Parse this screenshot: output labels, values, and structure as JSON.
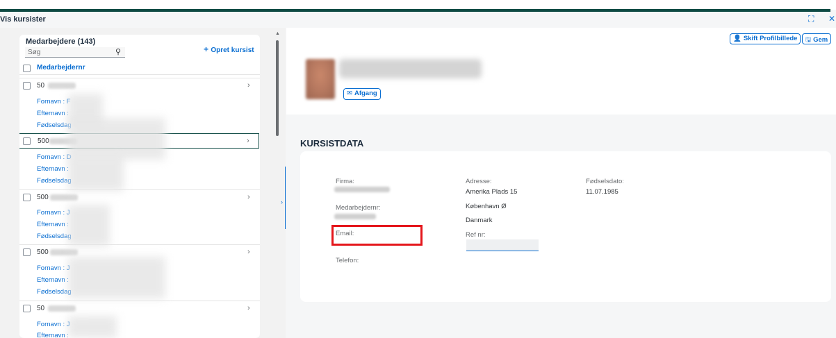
{
  "page": {
    "title": "Vis kursister"
  },
  "window_icons": {
    "fullscreen": "fullscreen-icon",
    "close": "close-icon"
  },
  "colors": {
    "accent": "#0a6ed1",
    "header_bar": "#0e4a43",
    "highlight": "#e4161b"
  },
  "employee_list": {
    "title": "Medarbejdere (143)",
    "search_placeholder": "Søg",
    "create_label": "Opret kursist",
    "column_header": "Medarbejdernr",
    "rows": [
      {
        "number": "50",
        "first_name_label": "Fornavn : F",
        "last_name_label": "Efternavn :",
        "birthday_label": "Fødselsdag"
      },
      {
        "number": "500",
        "first_name_label": "Fornavn : D",
        "last_name_label": "Efternavn :",
        "birthday_label": "Fødselsdag"
      },
      {
        "number": "500",
        "first_name_label": "Fornavn : J",
        "last_name_label": "Efternavn :",
        "birthday_label": "Fødselsdag"
      },
      {
        "number": "500",
        "first_name_label": "Fornavn : J",
        "last_name_label": "Efternavn :",
        "birthday_label": "Fødselsdag"
      },
      {
        "number": "50",
        "first_name_label": "Fornavn : J",
        "last_name_label": "Efternavn :",
        "birthday_label": ""
      }
    ]
  },
  "profile": {
    "change_photo_label": "Skift Profilbillede",
    "save_label": "Gem",
    "afgang_label": "Afgang"
  },
  "kursistdata": {
    "title": "KURSISTDATA",
    "firma_label": "Firma:",
    "medarbejdernr_label": "Medarbejdernr:",
    "email_label": "Email:",
    "telefon_label": "Telefon:",
    "adresse_label": "Adresse:",
    "adresse_line1": "Amerika Plads 15",
    "adresse_line2": "København Ø",
    "adresse_line3": "Danmark",
    "refnr_label": "Ref nr:",
    "fodselsdato_label": "Fødselsdato:",
    "fodselsdato_value": "11.07.1985"
  }
}
